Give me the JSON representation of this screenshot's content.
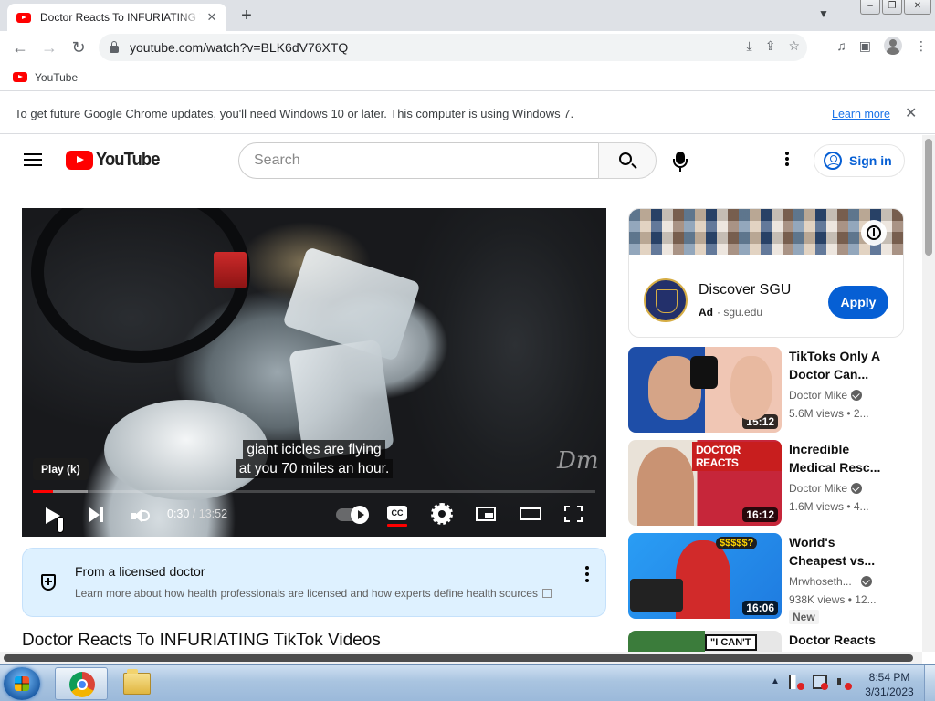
{
  "browser": {
    "tab_title": "Doctor Reacts To INFURIATING TikTok Videos",
    "url": "youtube.com/watch?v=BLK6dV76XTQ",
    "bookmark": "YouTube",
    "info_text": "To get future Google Chrome updates, you'll need Windows 10 or later. This computer is using Windows 7.",
    "info_link": "Learn more"
  },
  "youtube": {
    "logo_text": "YouTube",
    "search_placeholder": "Search",
    "sign_in": "Sign in"
  },
  "player": {
    "caption_line1": "giant icicles are flying",
    "caption_line2": "at you 70 miles an hour.",
    "tooltip": "Play (k)",
    "current_time": "0:30",
    "separator": " / ",
    "duration": "13:52",
    "cc_label": "CC",
    "watermark": "Dm",
    "progress_played": 0.036,
    "progress_loaded": 0.097,
    "progress_color": "#ff0000"
  },
  "notice": {
    "title": "From a licensed doctor",
    "description": "Learn more about how health professionals are licensed and how experts define health sources"
  },
  "video_title": "Doctor Reacts To INFURIATING TikTok Videos",
  "ad": {
    "title": "Discover SGU",
    "ad_label": "Ad",
    "domain": "sgu.edu",
    "cta": "Apply",
    "cta_color": "#065fd4"
  },
  "recommendations": [
    {
      "title1": "TikToks Only A",
      "title2": "Doctor Can...",
      "channel": "Doctor Mike",
      "meta": "5.6M views  • 2...",
      "duration": "15:12",
      "thumb_text": ""
    },
    {
      "title1": "Incredible",
      "title2": "Medical Resc...",
      "channel": "Doctor Mike",
      "meta": "1.6M views  • 4...",
      "duration": "16:12",
      "thumb_text": "DOCTOR REACTS"
    },
    {
      "title1": "World's",
      "title2": "Cheapest vs...",
      "channel": "Mrwhoseth...",
      "meta": "938K views  • 12...",
      "duration": "16:06",
      "thumb_text": "$$$$$?",
      "badge": "New"
    },
    {
      "title1": "Doctor Reacts",
      "title2": "",
      "channel": "",
      "meta": "",
      "duration": "",
      "thumb_text": "\"I CAN'T"
    }
  ],
  "taskbar": {
    "time": "8:54 PM",
    "date": "3/31/2023"
  }
}
